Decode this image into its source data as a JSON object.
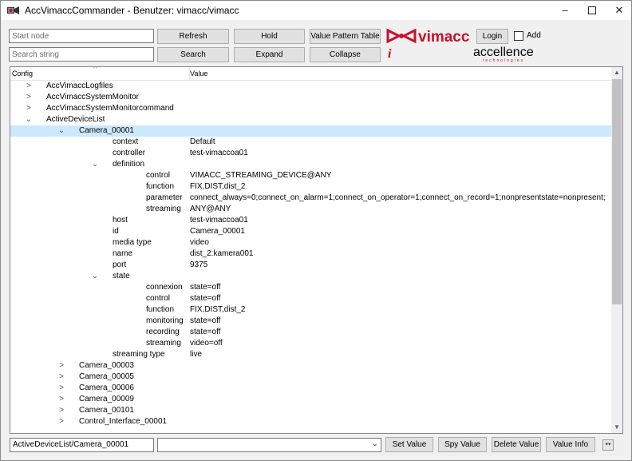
{
  "window": {
    "title": "AccVimaccCommander - Benutzer: vimacc/vimacc",
    "minimize_glyph": "–",
    "close_glyph": "✕"
  },
  "toolbar": {
    "start_node_placeholder": "Start node",
    "search_placeholder": "Search string",
    "refresh_label": "Refresh",
    "hold_label": "Hold",
    "value_pattern_table_label": "Value Pattern Table",
    "search_label": "Search",
    "expand_label": "Expand",
    "collapse_label": "Collapse",
    "login_label": "Login",
    "add_label": "Add",
    "info_glyph": "i",
    "logo_vimacc_text": "vimacc",
    "logo_accellence_text": "accellence",
    "logo_accellence_subtext": "technologies"
  },
  "tree": {
    "col_config": "Config",
    "col_value": "Value",
    "rows": [
      {
        "key": "AccVimaccLogfiles",
        "value": "",
        "expander": ">"
      },
      {
        "key": "AccVimaccSystemMonitor",
        "value": "",
        "expander": ">"
      },
      {
        "key": "AccVimaccSystemMonitorcommand",
        "value": "",
        "expander": ">"
      },
      {
        "key": "ActiveDeviceList",
        "value": "",
        "expander": "⌄"
      },
      {
        "key": "Camera_00001",
        "value": "",
        "expander": "⌄"
      },
      {
        "key": "context",
        "value": "Default",
        "expander": ""
      },
      {
        "key": "controller",
        "value": "test-vimaccoa01",
        "expander": ""
      },
      {
        "key": "definition",
        "value": "",
        "expander": "⌄"
      },
      {
        "key": "control",
        "value": "VIMACC_STREAMING_DEVICE@ANY",
        "expander": ""
      },
      {
        "key": "function",
        "value": "FIX,DIST,dist_2",
        "expander": ""
      },
      {
        "key": "parameter",
        "value": "connect_always=0;connect_on_alarm=1;connect_on_operator=1;connect_on_record=1;nonpresentstate=nonpresent;",
        "expander": ""
      },
      {
        "key": "streaming",
        "value": "ANY@ANY",
        "expander": ""
      },
      {
        "key": "host",
        "value": "test-vimaccoa01",
        "expander": ""
      },
      {
        "key": "id",
        "value": "Camera_00001",
        "expander": ""
      },
      {
        "key": "media type",
        "value": "video",
        "expander": ""
      },
      {
        "key": "name",
        "value": "dist_2:kamera001",
        "expander": ""
      },
      {
        "key": "port",
        "value": "9375",
        "expander": ""
      },
      {
        "key": "state",
        "value": "",
        "expander": "⌄"
      },
      {
        "key": "connexion",
        "value": "state=off",
        "expander": ""
      },
      {
        "key": "control",
        "value": "state=off",
        "expander": ""
      },
      {
        "key": "function",
        "value": "FIX,DIST,dist_2",
        "expander": ""
      },
      {
        "key": "monitoring",
        "value": "state=off",
        "expander": ""
      },
      {
        "key": "recording",
        "value": "state=off",
        "expander": ""
      },
      {
        "key": "streaming",
        "value": "video=off",
        "expander": ""
      },
      {
        "key": "streaming type",
        "value": "live",
        "expander": ""
      },
      {
        "key": "Camera_00003",
        "value": "",
        "expander": ">"
      },
      {
        "key": "Camera_00005",
        "value": "",
        "expander": ">"
      },
      {
        "key": "Camera_00006",
        "value": "",
        "expander": ">"
      },
      {
        "key": "Camera_00009",
        "value": "",
        "expander": ">"
      },
      {
        "key": "Camera_00101",
        "value": "",
        "expander": ">"
      },
      {
        "key": "Control_Interface_00001",
        "value": "",
        "expander": ">"
      }
    ]
  },
  "bottom": {
    "path_value": "ActiveDeviceList/Camera_00001",
    "value_combo": "",
    "set_value_label": "Set Value",
    "spy_value_label": "Spy Value",
    "delete_value_label": "Delete Value",
    "value_info_label": "Value Info"
  },
  "colors": {
    "selection": "#cce8ff",
    "logo_red": "#c8102e"
  }
}
